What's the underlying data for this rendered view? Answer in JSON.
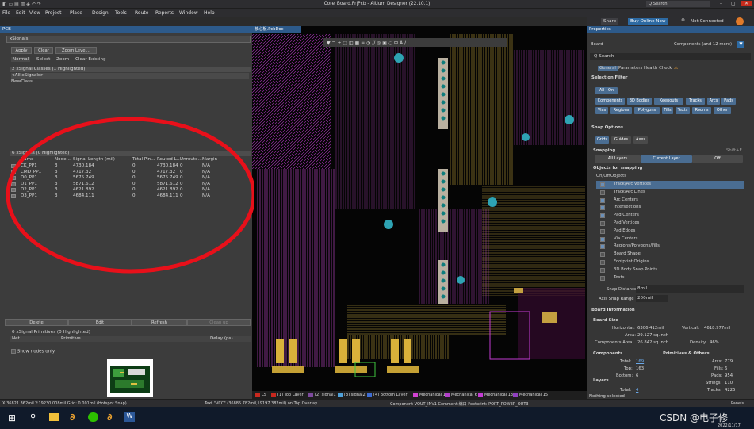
{
  "app": {
    "title": "Core_Board.PrjPcb - Altium Designer (22.10.1)",
    "search": "Q Search"
  },
  "menu": [
    "File",
    "Edit",
    "View",
    "Project",
    "Place",
    "Design",
    "Tools",
    "Route",
    "Reports",
    "Window",
    "Help"
  ],
  "top_right": {
    "share": "Share",
    "buy": "Buy Online Now",
    "not_connected": "Not Connected"
  },
  "left_panel": {
    "title": "PCB",
    "mode": "xSignals",
    "buttons": {
      "apply": "Apply",
      "clear": "Clear",
      "zoom": "Zoom Level..."
    },
    "normal": "Normal",
    "select": "Select",
    "zoom_chk": "Zoom",
    "clear_existing": "Clear Existing",
    "classes_header": "2 xSignal Classes (1 Highlighted)",
    "classes": [
      "<All xSignals>",
      "NewClass"
    ],
    "xsignals_header": "6 xSignals (0 Highlighted)",
    "columns": [
      "Name",
      "Node ...",
      "Signal Length (mil)",
      "Total Pin...",
      "Routed L...",
      "Unroute...",
      "Margin"
    ],
    "rows": [
      [
        "CK_PP1",
        "3",
        "4730.184",
        "0",
        "4730.184",
        "0",
        "N/A"
      ],
      [
        "CMD_PP1",
        "3",
        "4717.32",
        "0",
        "4717.32",
        "0",
        "N/A"
      ],
      [
        "D0_PP1",
        "3",
        "5675.749",
        "0",
        "5675.749",
        "0",
        "N/A"
      ],
      [
        "D1_PP1",
        "3",
        "5871.612",
        "0",
        "5871.612",
        "0",
        "N/A"
      ],
      [
        "D2_PP1",
        "3",
        "4621.892",
        "0",
        "4621.892",
        "0",
        "N/A"
      ],
      [
        "D3_PP1",
        "3",
        "4684.111",
        "0",
        "4684.111",
        "0",
        "N/A"
      ]
    ],
    "actions": {
      "delete": "Delete",
      "edit": "Edit",
      "refresh": "Refresh",
      "cleanup": "Clean up"
    },
    "prims_header": "0 xSignal Primitives (0 Highlighted)",
    "prim_cols": [
      "Net",
      "Primitive",
      "Delay (ps)"
    ],
    "show_nodes": "Show nodes only"
  },
  "doc_tab": "核心板.PcbDoc",
  "layers": [
    "LS",
    "[1] Top Layer",
    "[2] signal1",
    "[3] signal2",
    "[4] Bottom Layer",
    "Mechanical 1",
    "Mechanical 6",
    "Mechanical 13",
    "Mechanical 15"
  ],
  "layer_colors": [
    "#c8281e",
    "#c8281e",
    "#7e4a9e",
    "#4fa0d8",
    "#3e6cd1",
    "#d142d1",
    "#b13ec8",
    "#c43cd3",
    "#9040c0"
  ],
  "properties": {
    "title": "Properties",
    "board": "Board",
    "components": "Components (and 12 more)",
    "search": "Search",
    "tabs": [
      "General",
      "Parameters",
      "Health Check"
    ],
    "selection_filter": "Selection Filter",
    "all_on": "All - On",
    "filters": [
      "Components",
      "3D Bodies",
      "Keepouts",
      "Tracks",
      "Arcs",
      "Pads",
      "Vias",
      "Regions",
      "Polygons",
      "Fills",
      "Texts",
      "Rooms",
      "Other"
    ],
    "snap_options": "Snap Options",
    "snap_tabs": [
      "Grids",
      "Guides",
      "Axes"
    ],
    "snapping": "Snapping",
    "shortcut": "Shift+E",
    "snap_modes": [
      "All Layers",
      "Current Layer",
      "Off"
    ],
    "objects_for_snapping": "Objects for snapping",
    "onoff": "On/Off",
    "objects": "Objects",
    "snap_items": [
      {
        "label": "Track/Arc Vertices",
        "on": true
      },
      {
        "label": "Track/Arc Lines",
        "on": false
      },
      {
        "label": "Arc Centers",
        "on": true
      },
      {
        "label": "Intersections",
        "on": true
      },
      {
        "label": "Pad Centers",
        "on": true
      },
      {
        "label": "Pad Vertices",
        "on": false
      },
      {
        "label": "Pad Edges",
        "on": false
      },
      {
        "label": "Via Centers",
        "on": true
      },
      {
        "label": "Regions/Polygons/Fills",
        "on": true
      },
      {
        "label": "Board Shape",
        "on": false
      },
      {
        "label": "Footprint Origins",
        "on": false
      },
      {
        "label": "3D Body Snap Points",
        "on": false
      },
      {
        "label": "Texts",
        "on": false
      }
    ],
    "snap_distance_label": "Snap Distance",
    "snap_distance": "8mil",
    "axis_snap_label": "Axis Snap Range",
    "axis_snap": "200mil",
    "board_info": "Board Information",
    "board_size": "Board Size",
    "horizontal_label": "Horizontal:",
    "horizontal": "6306.412mil",
    "vertical_label": "Vertical:",
    "vertical": "4618.977mil",
    "area_label": "Area:",
    "area": "29.127 sq.inch",
    "comp_area_label": "Components Area:",
    "comp_area": "26.842 sq.inch",
    "density_label": "Density:",
    "density": "46%",
    "components_h": "Components",
    "prims_h": "Primitives & Others",
    "total_label": "Total:",
    "total": "169",
    "top_label": "Top:",
    "top": "163",
    "bottom_label": "Bottom:",
    "bottom": "6",
    "arcs_label": "Arcs:",
    "arcs": "779",
    "fills_label": "Fills:",
    "fills": "6",
    "pads_label": "Pads:",
    "pads": "954",
    "strings_label": "Strings:",
    "strings": "110",
    "tracks_label": "Tracks:",
    "tracks": "4225",
    "layers_h": "Layers",
    "layers_total_label": "Total:",
    "layers_total": "4",
    "nothing_selected": "Nothing selected"
  },
  "status": {
    "coords": "X:36821.362mil Y:19230.008mil   Grid: 0.001mil   (Hotspot Snap)",
    "text": "Text \"VCC\" (36885.782mil,19197.382mil) on Top Overlay",
    "component": "Component VOUT_INV1 Comment:编口 Footprint: PORT_POWER_OUT3",
    "panels": "Panels"
  },
  "watermark": "CSDN @电子修",
  "date": "2022/11/17"
}
